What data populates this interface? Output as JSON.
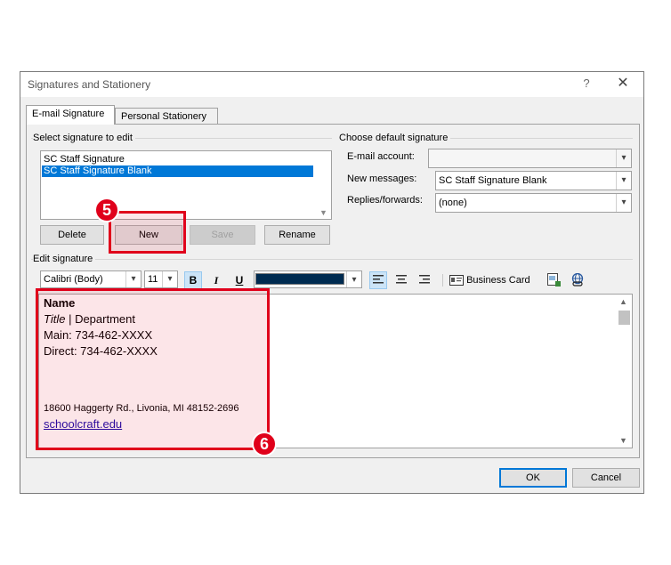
{
  "window": {
    "title": "Signatures and Stationery",
    "help": "?",
    "close": "✕"
  },
  "tabs": [
    {
      "label": "E-mail Signature",
      "active": true
    },
    {
      "label": "Personal Stationery",
      "active": false
    }
  ],
  "select_group": {
    "label": "Select signature to edit",
    "items": [
      "SC Staff Signature",
      "SC Staff Signature Blank"
    ],
    "selected_index": 1
  },
  "buttons": {
    "delete": "Delete",
    "new": "New",
    "save": "Save",
    "rename": "Rename"
  },
  "default_group": {
    "label": "Choose default signature",
    "email_account_label": "E-mail account:",
    "email_account_value": "",
    "new_messages_label": "New messages:",
    "new_messages_value": "SC Staff Signature Blank",
    "replies_label": "Replies/forwards:",
    "replies_value": "(none)"
  },
  "edit_group": {
    "label": "Edit signature",
    "font": "Calibri (Body)",
    "size": "11",
    "bold": "B",
    "italic": "I",
    "underline": "U",
    "font_color": "#002b50",
    "business_card": "Business Card"
  },
  "signature": {
    "name": "Name",
    "title": "Title",
    "separator": " | ",
    "department": "Department",
    "main": "Main: 734-462-XXXX",
    "direct": "Direct: 734-462-XXXX",
    "address": "18600 Haggerty Rd., Livonia, MI 48152-2696",
    "link": "schoolcraft.edu"
  },
  "annotations": {
    "step5": "5",
    "step6": "6",
    "highlight_color": "#e0001b"
  },
  "footer": {
    "ok": "OK",
    "cancel": "Cancel"
  }
}
